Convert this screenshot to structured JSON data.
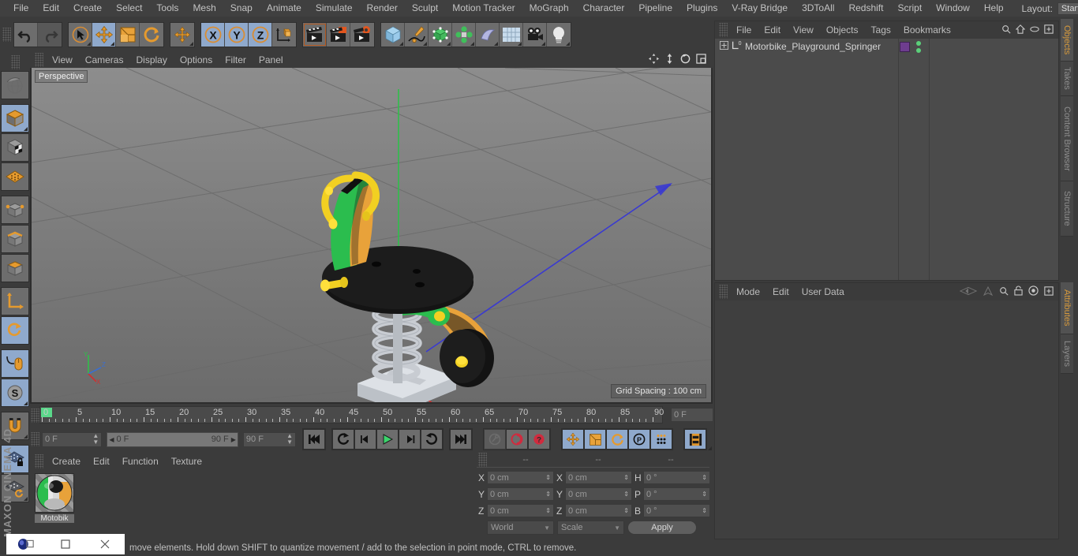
{
  "app": {
    "brand": "MAXON",
    "brand2": "CINEMA 4D"
  },
  "menubar": {
    "items": [
      "File",
      "Edit",
      "Create",
      "Select",
      "Tools",
      "Mesh",
      "Snap",
      "Animate",
      "Simulate",
      "Render",
      "Sculpt",
      "Motion Tracker",
      "MoGraph",
      "Character",
      "Pipeline",
      "Plugins",
      "V-Ray Bridge",
      "3DToAll",
      "Redshift",
      "Script",
      "Window",
      "Help"
    ],
    "layout_label": "Layout:",
    "layout_value": "Startup",
    "search_icon": "search-icon"
  },
  "toolbar": {
    "groups": [
      {
        "name": "undo-redo",
        "buttons": [
          {
            "name": "undo-button",
            "icon": "undo-arrow-icon",
            "active": false
          },
          {
            "name": "redo-button",
            "icon": "redo-arrow-icon",
            "active": false
          }
        ]
      },
      {
        "name": "transform-tools",
        "buttons": [
          {
            "name": "selection-tool",
            "icon": "cursor-circle-icon",
            "active": false
          },
          {
            "name": "move-tool",
            "icon": "move-arrows-icon",
            "active": true
          },
          {
            "name": "scale-tool",
            "icon": "scale-box-icon",
            "active": false
          },
          {
            "name": "rotate-tool",
            "icon": "rotate-circle-icon",
            "active": false
          }
        ]
      },
      {
        "name": "placement-tool",
        "buttons": [
          {
            "name": "placement-move-tool",
            "icon": "move-arrows-icon",
            "active": false
          }
        ]
      },
      {
        "name": "axis-locks",
        "buttons": [
          {
            "name": "lock-x-axis",
            "icon": "x-axis-icon",
            "active": true,
            "label": "X"
          },
          {
            "name": "lock-y-axis",
            "icon": "y-axis-icon",
            "active": true,
            "label": "Y"
          },
          {
            "name": "lock-z-axis",
            "icon": "z-axis-icon",
            "active": true,
            "label": "Z"
          },
          {
            "name": "world-object-axis-toggle",
            "icon": "world-cube-icon",
            "active": false
          }
        ]
      },
      {
        "name": "render-tools",
        "buttons": [
          {
            "name": "render-view-button",
            "icon": "clapperboard-icon",
            "active": false
          },
          {
            "name": "render-to-picture-viewer-button",
            "icon": "clapperboard-render-icon",
            "active": false
          },
          {
            "name": "render-settings-button",
            "icon": "clapperboard-gear-icon",
            "active": false
          }
        ]
      },
      {
        "name": "create-objects",
        "buttons": [
          {
            "name": "add-cube-button",
            "icon": "cube-icon",
            "active": false
          },
          {
            "name": "add-spline-button",
            "icon": "pen-spline-icon",
            "active": false
          },
          {
            "name": "add-generator-button",
            "icon": "green-cube-nurbs-icon",
            "active": false
          },
          {
            "name": "add-mograph-button",
            "icon": "green-cloner-icon",
            "active": false
          },
          {
            "name": "add-deformer-button",
            "icon": "bend-deformer-icon",
            "active": false
          },
          {
            "name": "add-environment-button",
            "icon": "floor-grid-icon",
            "active": false
          },
          {
            "name": "add-camera-button",
            "icon": "camera-icon",
            "active": false
          },
          {
            "name": "add-light-button",
            "icon": "light-bulb-icon",
            "active": false
          }
        ]
      }
    ]
  },
  "left_toolbar": {
    "buttons": [
      {
        "name": "undo-view-button",
        "icon": "globe-sphere-icon",
        "active": false
      },
      {
        "name": "model-mode-button",
        "icon": "model-cube-icon",
        "active": true
      },
      {
        "name": "texture-mode-button",
        "icon": "texture-checker-cube-icon",
        "active": false
      },
      {
        "name": "workplane-mode-button",
        "icon": "orange-grid-plane-icon",
        "active": false
      },
      {
        "name": "points-mode-button",
        "icon": "points-cube-icon",
        "active": false
      },
      {
        "name": "edges-mode-button",
        "icon": "edges-cube-icon",
        "active": false
      },
      {
        "name": "polygons-mode-button",
        "icon": "polygons-cube-icon",
        "active": false
      },
      {
        "name": "axis-mode-button",
        "icon": "axis-l-icon",
        "active": false
      },
      {
        "name": "enable-axis-button",
        "icon": "axis-rotate-icon",
        "active": false
      },
      {
        "name": "viewport-solo-button",
        "icon": "mouse-cursor-icon",
        "active": true
      },
      {
        "name": "snap-settings-button",
        "icon": "snap-s-icon",
        "active": true
      },
      {
        "name": "magnet-tool-button",
        "icon": "magnet-icon",
        "active": false
      },
      {
        "name": "lock-workplane-button",
        "icon": "grid-lock-icon",
        "active": true
      },
      {
        "name": "workplane-rotate-button",
        "icon": "grid-rotate-icon",
        "active": false
      }
    ]
  },
  "viewport": {
    "menu": [
      "View",
      "Cameras",
      "Display",
      "Options",
      "Filter",
      "Panel"
    ],
    "nav_icons": [
      "pan-icon",
      "dolly-icon",
      "orbit-icon",
      "maximize-icon"
    ],
    "label": "Perspective",
    "grid_spacing": "Grid Spacing : 100 cm",
    "axis_labels": {
      "x": "X",
      "y": "Y",
      "z": "Z"
    },
    "scene_object": "playground springer motorbike"
  },
  "timeline": {
    "ticks": [
      0,
      5,
      10,
      15,
      20,
      25,
      30,
      35,
      40,
      45,
      50,
      55,
      60,
      65,
      70,
      75,
      80,
      85,
      90
    ],
    "min": 0,
    "max": 90,
    "current_frame_field": "0 F"
  },
  "powerslider": {
    "current_frame": "0 F",
    "range_start": "0 F",
    "range_end": "90 F",
    "end_frame_field": "90 F",
    "buttons": [
      {
        "name": "go-to-start-button",
        "icon": "skip-start-icon"
      },
      {
        "name": "go-to-previous-key-button",
        "icon": "prev-key-icon"
      },
      {
        "name": "go-to-previous-frame-button",
        "icon": "step-back-icon"
      },
      {
        "name": "play-button",
        "icon": "play-icon"
      },
      {
        "name": "go-to-next-frame-button",
        "icon": "step-forward-icon"
      },
      {
        "name": "go-to-next-key-button",
        "icon": "next-key-icon"
      },
      {
        "name": "go-to-end-button",
        "icon": "skip-end-icon"
      },
      {
        "name": "record-active-objects-button",
        "icon": "key-disabled-icon"
      },
      {
        "name": "autokeying-button",
        "icon": "autokey-circle-icon"
      },
      {
        "name": "keyframe-selection-button",
        "icon": "question-circle-icon"
      },
      {
        "name": "position-key-toggle",
        "icon": "move-arrows-icon"
      },
      {
        "name": "scale-key-toggle",
        "icon": "scale-box-icon"
      },
      {
        "name": "rotation-key-toggle",
        "icon": "rotate-circle-icon"
      },
      {
        "name": "parameter-key-toggle",
        "icon": "p-circle-icon"
      },
      {
        "name": "point-level-animation-toggle",
        "icon": "dots-grid-icon"
      },
      {
        "name": "timeline-view-button",
        "icon": "film-strip-icon"
      }
    ]
  },
  "material_manager": {
    "menu": [
      "Create",
      "Edit",
      "Function",
      "Texture"
    ],
    "materials": [
      {
        "name": "Motobik"
      }
    ]
  },
  "coordinates": {
    "headers": [
      "--",
      "--",
      "--"
    ],
    "rows": [
      {
        "pos_label": "X",
        "pos_value": "0 cm",
        "size_label": "X",
        "size_value": "0 cm",
        "rot_label": "H",
        "rot_value": "0 °"
      },
      {
        "pos_label": "Y",
        "pos_value": "0 cm",
        "size_label": "Y",
        "size_value": "0 cm",
        "rot_label": "P",
        "rot_value": "0 °"
      },
      {
        "pos_label": "Z",
        "pos_value": "0 cm",
        "size_label": "Z",
        "size_value": "0 cm",
        "rot_label": "B",
        "rot_value": "0 °"
      }
    ],
    "system_dropdown": "World",
    "mode_dropdown": "Scale",
    "apply_label": "Apply"
  },
  "object_manager": {
    "menu": [
      "File",
      "Edit",
      "View",
      "Objects",
      "Tags",
      "Bookmarks"
    ],
    "header_icons": [
      "search-icon",
      "home-icon",
      "eye-icon",
      "add-layer-icon"
    ],
    "objects": [
      {
        "name": "Motorbike_Playground_Springer",
        "level_badge": "0",
        "tag_color": "#6e3d8f"
      }
    ]
  },
  "attributes_manager": {
    "menu": [
      "Mode",
      "Edit",
      "User Data"
    ],
    "header_icons": [
      "back-nav-icon",
      "forward-nav-icon",
      "search-icon",
      "lock-icon",
      "pin-icon",
      "add-icon"
    ]
  },
  "right_tabs": {
    "top": [
      "Objects",
      "Takes",
      "Content Browser",
      "Structure"
    ],
    "top_selected": "Objects",
    "bottom": [
      "Attributes",
      "Layers"
    ],
    "bottom_selected": "Attributes"
  },
  "status_bar": {
    "text": "move elements. Hold down SHIFT to quantize movement / add to the selection in point mode, CTRL to remove."
  },
  "taskbar": {
    "buttons": [
      "app-icon",
      "restore-button",
      "close-button"
    ]
  },
  "colors": {
    "bg": "#3b3b3b",
    "panel": "#454545",
    "accent_orange": "#d79a3c",
    "active_blue": "#8fa9cc",
    "green": "#5ad88a"
  }
}
